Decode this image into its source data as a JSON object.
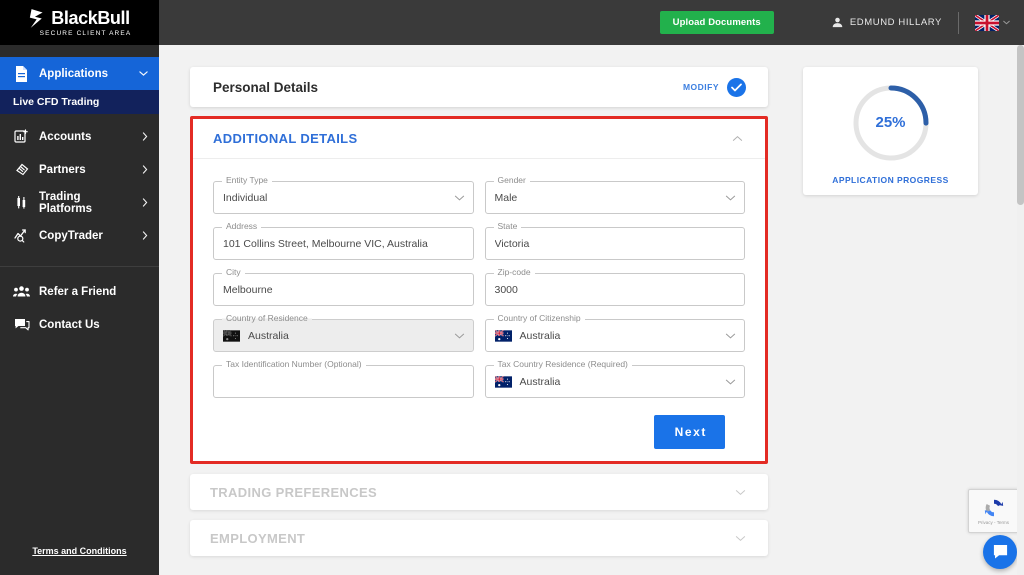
{
  "brand": {
    "name": "BlackBull",
    "tagline": "SECURE CLIENT AREA",
    "accent_blue": "#1565d8",
    "accent_green": "#22b14c",
    "highlight_red": "#e32b24"
  },
  "sidebar": {
    "items": [
      {
        "label": "Applications",
        "icon": "document-icon",
        "active": true,
        "has_chevron": true
      },
      {
        "label": "Accounts",
        "icon": "chart-plus-icon",
        "active": false,
        "has_chevron": true
      },
      {
        "label": "Partners",
        "icon": "handshake-icon",
        "active": false,
        "has_chevron": true
      },
      {
        "label": "Trading Platforms",
        "icon": "candlestick-icon",
        "active": false,
        "has_chevron": true
      },
      {
        "label": "CopyTrader",
        "icon": "trend-search-icon",
        "active": false,
        "has_chevron": true
      },
      {
        "label": "Refer a Friend",
        "icon": "people-icon",
        "active": false,
        "has_chevron": false
      },
      {
        "label": "Contact Us",
        "icon": "chat-icon",
        "active": false,
        "has_chevron": false
      }
    ],
    "subitem": "Live CFD Trading",
    "footer_link": "Terms and Conditions"
  },
  "topbar": {
    "upload_button": "Upload Documents",
    "user_name": "EDMUND HILLARY",
    "language_flag": "uk-flag-icon"
  },
  "personal_details": {
    "title": "Personal Details",
    "modify_label": "MODIFY",
    "status": "completed"
  },
  "additional_details": {
    "title": "ADDITIONAL DETAILS",
    "expanded": true,
    "fields": [
      {
        "label": "Entity Type",
        "value": "Individual",
        "type": "select",
        "disabled": false,
        "flag": null
      },
      {
        "label": "Gender",
        "value": "Male",
        "type": "select",
        "disabled": false,
        "flag": null
      },
      {
        "label": "Address",
        "value": "101 Collins Street, Melbourne VIC, Australia",
        "type": "text",
        "disabled": false,
        "flag": null
      },
      {
        "label": "State",
        "value": "Victoria",
        "type": "text",
        "disabled": false,
        "flag": null
      },
      {
        "label": "City",
        "value": "Melbourne",
        "type": "text",
        "disabled": false,
        "flag": null
      },
      {
        "label": "Zip-code",
        "value": "3000",
        "type": "text",
        "disabled": false,
        "flag": null
      },
      {
        "label": "Country of Residence",
        "value": "Australia",
        "type": "select",
        "disabled": true,
        "flag": "au-flag-icon"
      },
      {
        "label": "Country of Citizenship",
        "value": "Australia",
        "type": "select",
        "disabled": false,
        "flag": "au-flag-icon"
      },
      {
        "label": "Tax Identification Number (Optional)",
        "value": "",
        "type": "text",
        "disabled": false,
        "flag": null
      },
      {
        "label": "Tax Country Residence (Required)",
        "value": "Australia",
        "type": "select",
        "disabled": false,
        "flag": "au-flag-icon"
      }
    ],
    "next_button": "Next"
  },
  "collapsed_sections": [
    {
      "title": "TRADING PREFERENCES",
      "disabled": true
    },
    {
      "title": "EMPLOYMENT",
      "disabled": true
    }
  ],
  "progress": {
    "percent_label": "25%",
    "percent_value": 25,
    "caption": "APPLICATION PROGRESS",
    "ring_color": "#2d5fa8",
    "track_color": "#e4e4e4"
  },
  "widgets": {
    "recaptcha_text": "Privacy - Terms",
    "chat_icon": "chat-bubble-icon"
  }
}
